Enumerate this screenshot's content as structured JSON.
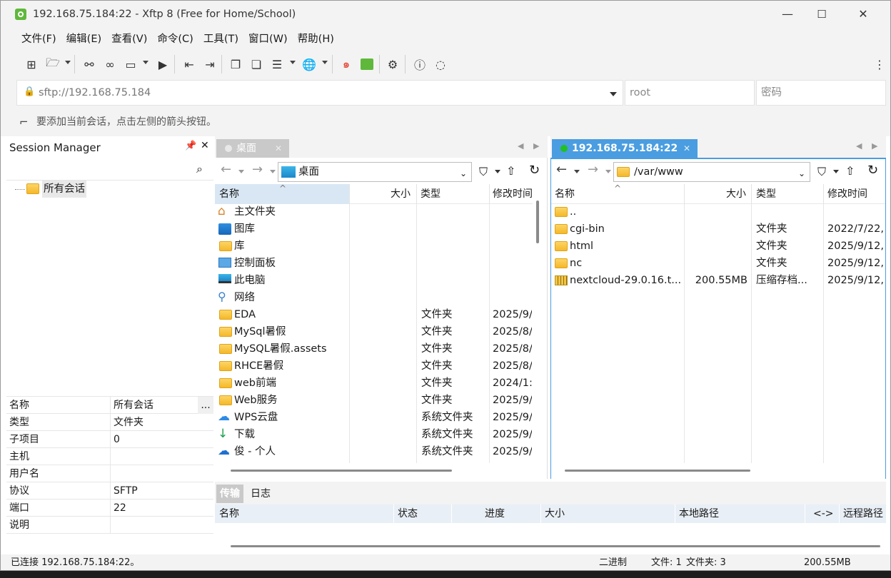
{
  "window": {
    "title": "192.168.75.184:22 - Xftp 8 (Free for Home/School)"
  },
  "menu": [
    "文件(F)",
    "编辑(E)",
    "查看(V)",
    "命令(C)",
    "工具(T)",
    "窗口(W)",
    "帮助(H)"
  ],
  "address": {
    "url": "sftp://192.168.75.184",
    "user_placeholder": "root",
    "password_placeholder": "密码"
  },
  "hint": "要添加当前会话，点击左侧的箭头按钮。",
  "session_manager": {
    "title": "Session Manager",
    "tree_root": "所有会话",
    "properties": [
      {
        "k": "名称",
        "v": "所有会话"
      },
      {
        "k": "类型",
        "v": "文件夹"
      },
      {
        "k": "子项目",
        "v": "0"
      },
      {
        "k": "主机",
        "v": ""
      },
      {
        "k": "用户名",
        "v": ""
      },
      {
        "k": "协议",
        "v": "SFTP"
      },
      {
        "k": "端口",
        "v": "22"
      },
      {
        "k": "说明",
        "v": ""
      }
    ],
    "more": "..."
  },
  "local": {
    "tab": "桌面",
    "path": "桌面",
    "headers": [
      "名称",
      "大小",
      "类型",
      "修改时间"
    ],
    "rows": [
      {
        "name": "主文件夹",
        "size": "",
        "type": "",
        "date": "",
        "icon": "home-icon"
      },
      {
        "name": "图库",
        "size": "",
        "type": "",
        "date": "",
        "icon": "gallery-icon"
      },
      {
        "name": "库",
        "size": "",
        "type": "",
        "date": "",
        "icon": "folder-icon"
      },
      {
        "name": "控制面板",
        "size": "",
        "type": "",
        "date": "",
        "icon": "control-panel-icon"
      },
      {
        "name": "此电脑",
        "size": "",
        "type": "",
        "date": "",
        "icon": "computer-icon"
      },
      {
        "name": "网络",
        "size": "",
        "type": "",
        "date": "",
        "icon": "network-icon"
      },
      {
        "name": "EDA",
        "size": "",
        "type": "文件夹",
        "date": "2025/9/",
        "icon": "folder-icon"
      },
      {
        "name": "MySql暑假",
        "size": "",
        "type": "文件夹",
        "date": "2025/8/",
        "icon": "folder-icon"
      },
      {
        "name": "MySQL暑假.assets",
        "size": "",
        "type": "文件夹",
        "date": "2025/8/",
        "icon": "folder-icon"
      },
      {
        "name": "RHCE暑假",
        "size": "",
        "type": "文件夹",
        "date": "2025/8/",
        "icon": "folder-icon"
      },
      {
        "name": "web前端",
        "size": "",
        "type": "文件夹",
        "date": "2024/1:",
        "icon": "folder-icon"
      },
      {
        "name": "Web服务",
        "size": "",
        "type": "文件夹",
        "date": "2025/9/",
        "icon": "folder-icon"
      },
      {
        "name": "WPS云盘",
        "size": "",
        "type": "系统文件夹",
        "date": "2025/9/",
        "icon": "cloud-icon"
      },
      {
        "name": "下载",
        "size": "",
        "type": "系统文件夹",
        "date": "2025/9/",
        "icon": "download-icon"
      },
      {
        "name": "俊 - 个人",
        "size": "",
        "type": "系统文件夹",
        "date": "2025/9/",
        "icon": "onedrive-icon"
      }
    ]
  },
  "remote": {
    "tab": "192.168.75.184:22",
    "path": "/var/www",
    "headers": [
      "名称",
      "大小",
      "类型",
      "修改时间"
    ],
    "rows": [
      {
        "name": "..",
        "size": "",
        "type": "",
        "date": "",
        "icon": "folder-icon"
      },
      {
        "name": "cgi-bin",
        "size": "",
        "type": "文件夹",
        "date": "2022/7/22,",
        "icon": "folder-icon"
      },
      {
        "name": "html",
        "size": "",
        "type": "文件夹",
        "date": "2025/9/12,",
        "icon": "folder-icon"
      },
      {
        "name": "nc",
        "size": "",
        "type": "文件夹",
        "date": "2025/9/12,",
        "icon": "folder-icon"
      },
      {
        "name": "nextcloud-29.0.16.t...",
        "size": "200.55MB",
        "type": "压缩存档...",
        "date": "2025/9/12,",
        "icon": "archive-icon"
      }
    ]
  },
  "transfer": {
    "tabs": [
      "传输",
      "日志"
    ],
    "headers": [
      "名称",
      "状态",
      "进度",
      "大小",
      "本地路径",
      "<->",
      "远程路径"
    ]
  },
  "statusbar": {
    "connected": "已连接 192.168.75.184:22。",
    "mode": "二进制",
    "files": "文件: 1",
    "folders": "文件夹: 3",
    "size": "200.55MB"
  },
  "colors": {
    "accent": "#4a9de0",
    "status_green": "#22c022",
    "folder": "#f5b82a"
  }
}
